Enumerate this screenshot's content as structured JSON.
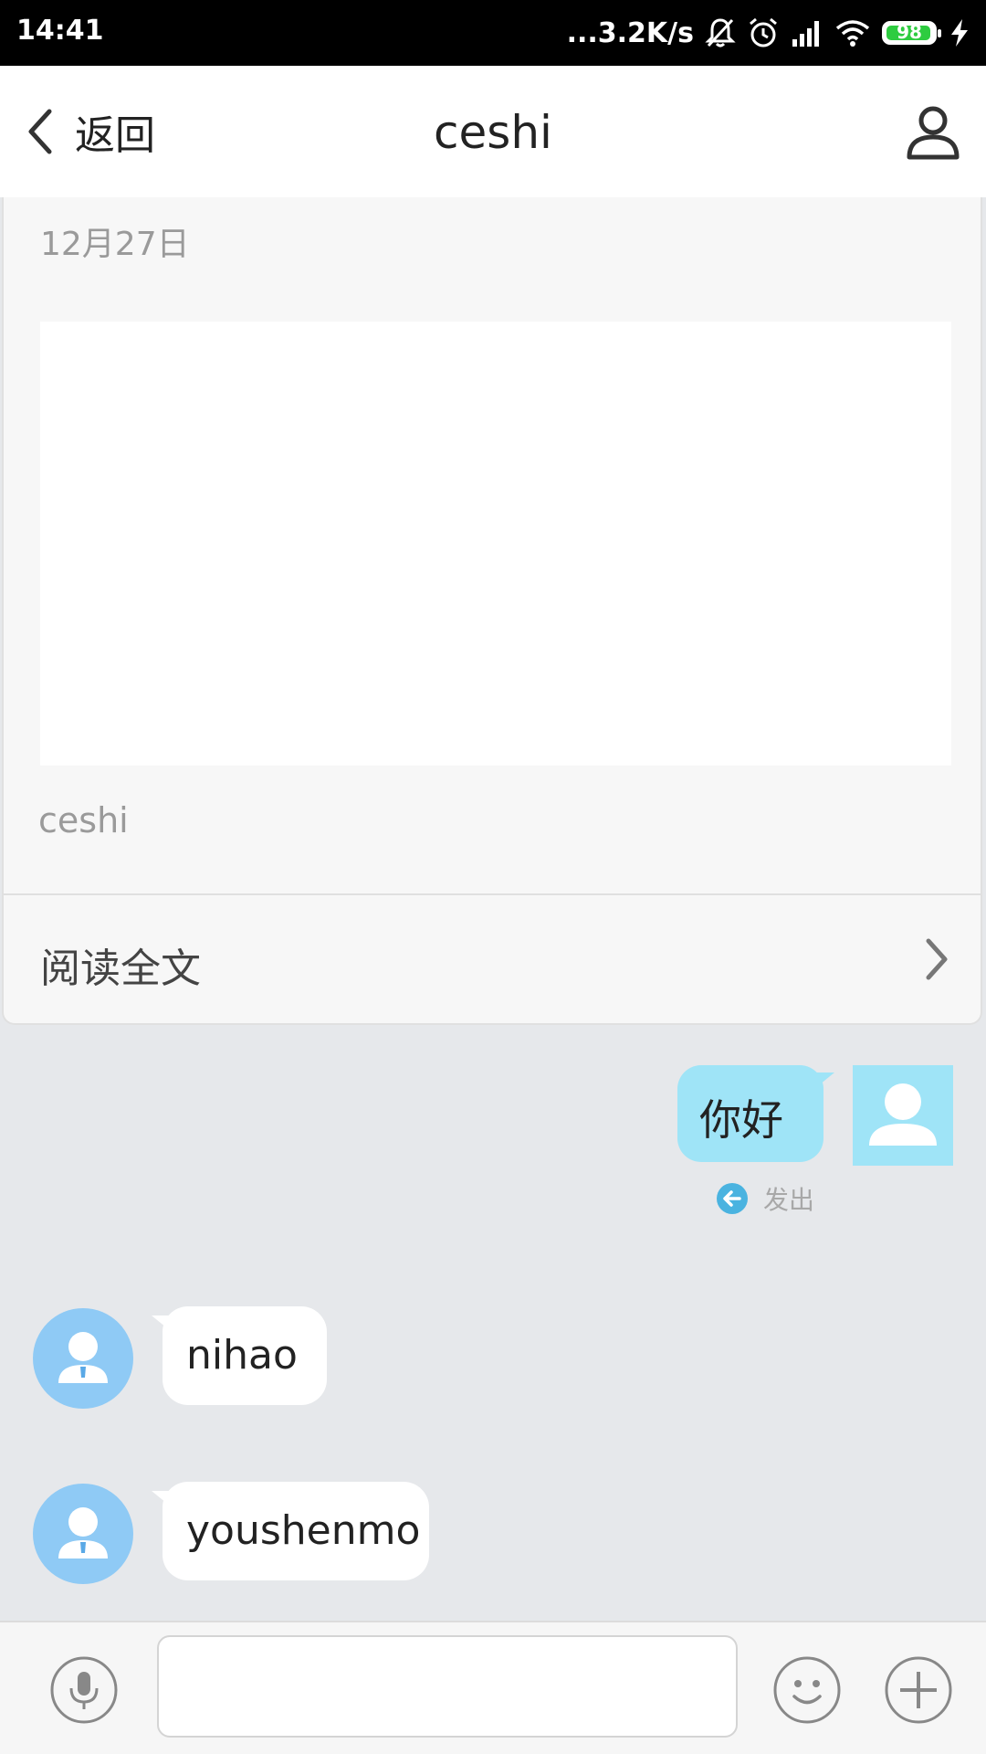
{
  "status_bar": {
    "time": "14:41",
    "network_speed": "...3.2K/s",
    "battery": "98",
    "icons": [
      "mute-bell-icon",
      "alarm-icon",
      "signal-icon",
      "wifi-icon",
      "battery-icon",
      "charging-icon"
    ]
  },
  "header": {
    "back_label": "返回",
    "title": "ceshi",
    "profile_icon": "person-icon"
  },
  "article": {
    "date": "12月27日",
    "author": "ceshi",
    "read_more_label": "阅读全文"
  },
  "messages": [
    {
      "direction": "outgoing",
      "text": "你好",
      "status": "发出"
    },
    {
      "direction": "incoming",
      "text": "nihao"
    },
    {
      "direction": "incoming",
      "text": "youshenmo"
    }
  ],
  "input_bar": {
    "value": "",
    "icons": [
      "microphone-icon",
      "emoji-icon",
      "plus-icon"
    ]
  },
  "colors": {
    "outgoing_bubble": "#9fe4f7",
    "incoming_avatar": "#8fcaf5",
    "chat_background": "#e6e8eb",
    "status_icon": "#4ab3e0"
  }
}
